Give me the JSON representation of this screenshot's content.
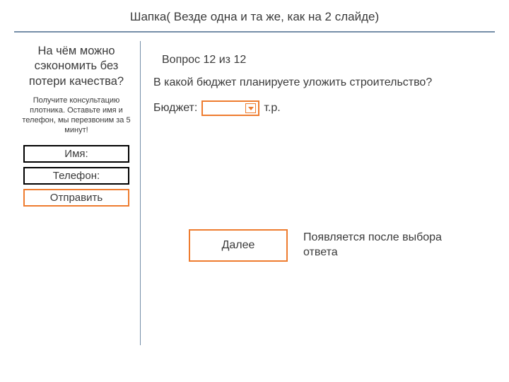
{
  "header": "Шапка( Везде одна и та же, как на 2 слайде)",
  "left": {
    "title": "На чём можно сэкономить без потери качества?",
    "sub": "Получите консультацию плотника. Оставьте имя и телефон, мы перезвоним за 5 минут!",
    "name_placeholder": "Имя:",
    "phone_placeholder": "Телефон:",
    "submit": "Отправить"
  },
  "right": {
    "counter": "Вопрос 12 из 12",
    "question": "В какой бюджет планируете уложить строительство?",
    "budget_label": "Бюджет:",
    "budget_unit": "т.р.",
    "next": "Далее",
    "note": "Появляется после выбора ответа"
  }
}
